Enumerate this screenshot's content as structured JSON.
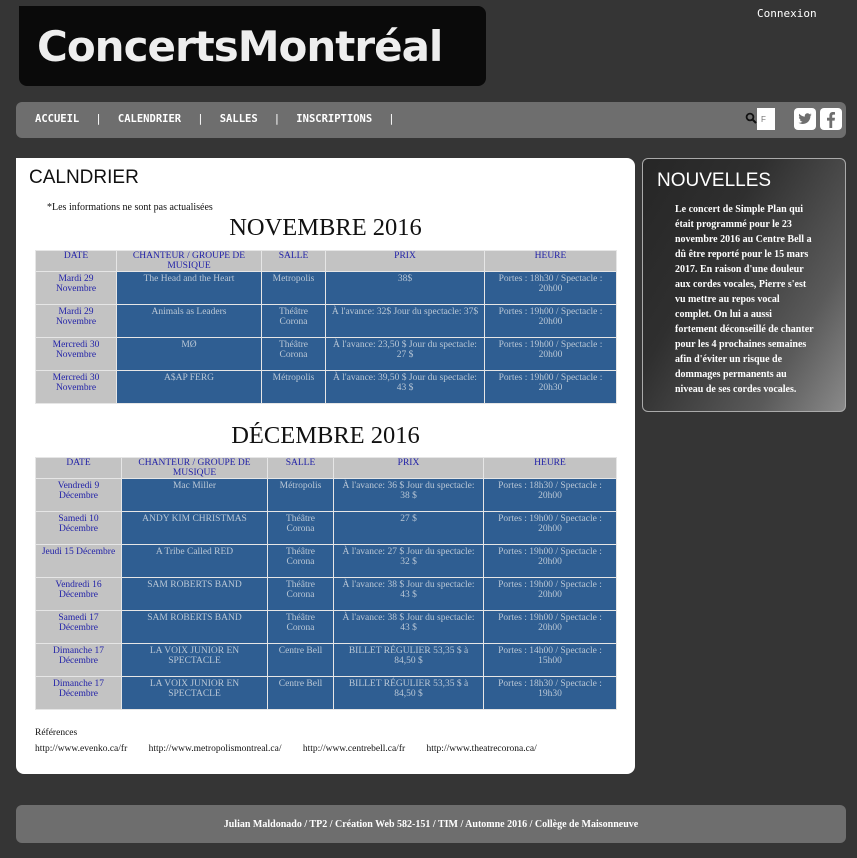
{
  "site": {
    "logo": "ConcertsMontréal",
    "login": "Connexion"
  },
  "nav": {
    "items": [
      "ACCUEIL",
      "CALENDRIER",
      "SALLES",
      "INSCRIPTIONS"
    ],
    "separator": "|",
    "search_placeholder": "F",
    "icons": [
      "search-icon",
      "twitter-icon",
      "facebook-icon"
    ]
  },
  "main": {
    "title": "CALNDRIER",
    "notice": "*Les informations ne sont pas actualisées",
    "columns": [
      "DATE",
      "CHANTEUR / GROUPE DE MUSIQUE",
      "SALLE",
      "PRIX",
      "HEURE"
    ],
    "months": [
      {
        "title": "NOVEMBRE 2016",
        "rows": [
          {
            "date": "Mardi 29 Novembre",
            "artist": "The Head and the Heart",
            "venue": "Metropolis",
            "price": "38$",
            "time": "Portes : 18h30 / Spectacle : 20h00"
          },
          {
            "date": "Mardi 29 Novembre",
            "artist": "Animals as Leaders",
            "venue": "Théâtre Corona",
            "price": "À l'avance: 32$ Jour du spectacle: 37$",
            "time": "Portes : 19h00 / Spectacle : 20h00"
          },
          {
            "date": "Mercredi 30 Novembre",
            "artist": "MØ",
            "venue": "Théâtre Corona",
            "price": "À l'avance: 23,50 $ Jour du spectacle: 27 $",
            "time": "Portes : 19h00 / Spectacle : 20h00"
          },
          {
            "date": "Mercredi 30 Novembre",
            "artist": "A$AP FERG",
            "venue": "Métropolis",
            "price": "À l'avance: 39,50 $ Jour du spectacle: 43 $",
            "time": "Portes : 19h00 / Spectacle : 20h30"
          }
        ]
      },
      {
        "title": "DÉCEMBRE 2016",
        "rows": [
          {
            "date": "Vendredi 9 Décembre",
            "artist": "Mac Miller",
            "venue": "Métropolis",
            "price": "À l'avance: 36 $ Jour du spectacle: 38 $",
            "time": "Portes : 18h30 / Spectacle : 20h00"
          },
          {
            "date": "Samedi 10 Décembre",
            "artist": "ANDY KIM CHRISTMAS",
            "venue": "Théâtre Corona",
            "price": "27 $",
            "time": "Portes : 19h00 / Spectacle : 20h00"
          },
          {
            "date": "Jeudi 15 Décembre",
            "artist": "A Tribe Called RED",
            "venue": "Théâtre Corona",
            "price": "À l'avance: 27 $ Jour du spectacle: 32 $",
            "time": "Portes : 19h00 / Spectacle : 20h00"
          },
          {
            "date": "Vendredi 16 Décembre",
            "artist": "SAM ROBERTS BAND",
            "venue": "Théâtre Corona",
            "price": "À l'avance: 38 $ Jour du spectacle: 43 $",
            "time": "Portes : 19h00 / Spectacle : 20h00"
          },
          {
            "date": "Samedi 17 Décembre",
            "artist": "SAM ROBERTS BAND",
            "venue": "Théâtre Corona",
            "price": "À l'avance: 38 $ Jour du spectacle: 43 $",
            "time": "Portes : 19h00 / Spectacle : 20h00"
          },
          {
            "date": "Dimanche 17 Décembre",
            "artist": "LA VOIX JUNIOR EN SPECTACLE",
            "venue": "Centre Bell",
            "price": "BILLET RÉGULIER 53,35 $ à 84,50 $",
            "time": "Portes : 14h00 / Spectacle : 15h00"
          },
          {
            "date": "Dimanche 17 Décembre",
            "artist": "LA VOIX JUNIOR EN SPECTACLE",
            "venue": "Centre Bell",
            "price": "BILLET RÉGULIER 53,35 $ à 84,50 $",
            "time": "Portes : 18h30 / Spectacle : 19h30"
          }
        ]
      }
    ],
    "references_label": "Références",
    "references": [
      "http://www.evenko.ca/fr",
      "http://www.metropolismontreal.ca/",
      "http://www.centrebell.ca/fr",
      "http://www.theatrecorona.ca/"
    ]
  },
  "news": {
    "title": "NOUVELLES",
    "text": "Le concert de Simple Plan qui était programmé pour le 23 novembre 2016 au Centre Bell a dû être reporté pour le 15 mars 2017. En raison d'une douleur aux cordes vocales, Pierre s'est vu mettre au repos vocal complet. On lui a aussi fortement déconseillé de chanter pour les 4 prochaines semaines afin d'éviter un risque de dommages permanents au niveau de ses cordes vocales."
  },
  "footer": {
    "text": "Julian Maldonado / TP2 / Création Web 582-151 / TIM / Automne 2016 / Collège de Maisonneuve"
  },
  "colors": {
    "background": "#353535",
    "nav": "#6e6e6e",
    "table_cell": "#2f5e92",
    "table_header": "#c3c3c3",
    "header_text": "#2222a8"
  }
}
